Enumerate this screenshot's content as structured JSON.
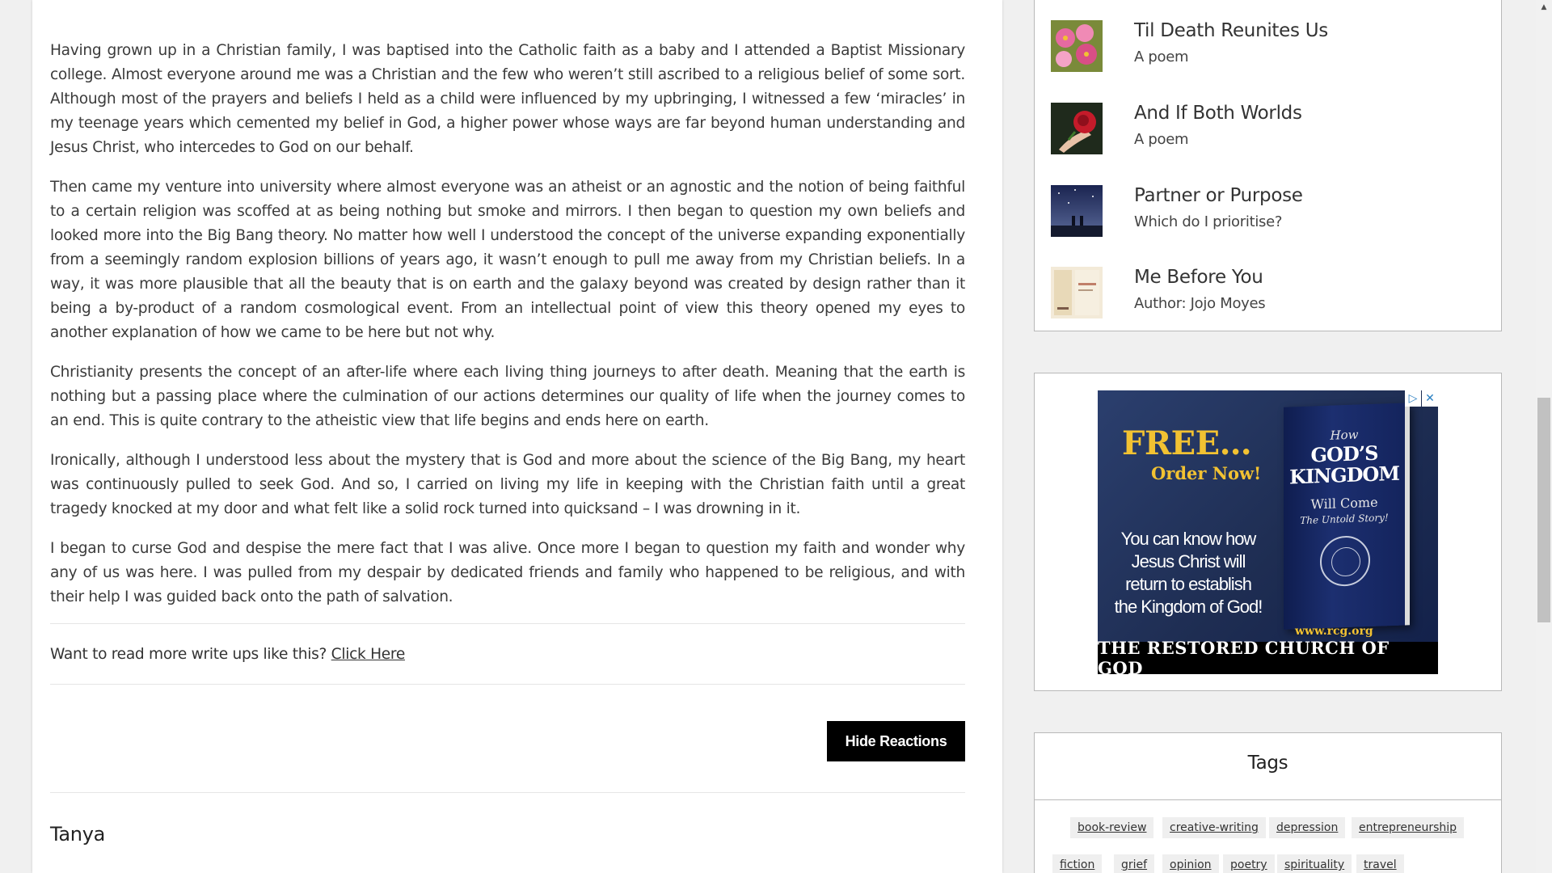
{
  "article": {
    "paragraphs": [
      "Having grown up in a Christian family, I was baptised into the Catholic faith as a baby and I attended a Baptist Missionary college. Almost everyone around me was a Christian and the few who weren’t still ascribed to a religious belief of some sort. Although most of the prayers and beliefs I held as a child were influenced by my upbringing, I witnessed a few ‘miracles’ in my teenage years which cemented my belief in God, a higher power whose ways are far beyond human understanding and Jesus Christ, who intercedes to God on our behalf.",
      "Then came my venture into university where almost everyone was an atheist or an agnostic and the notion of being faithful to a certain religion was scoffed at as being nothing but smoke and mirrors. I then began to question my own beliefs and looked more into the Big Bang theory. No matter how well I understood the concept of the universe expanding exponentially from a seemingly random explosion billions of years ago, it wasn’t enough to pull me away from my Christian beliefs. In a way, it was more plausible that all the beauty that is on earth and the galaxy beyond was created by design rather than it being a by-product of a random cosmological event. From an intellectual point of view this theory opened my eyes to another explanation of how we came to be here but not why.",
      "Christianity presents the concept of an after-life where each living thing journeys to after death. Meaning that the earth is nothing but a passing place where the culmination of our actions determines our quality of life when the journey comes to an end. This is quite contrary to the atheistic view that life begins and ends here on earth.",
      "Ironically, although I understood less about the mystery that is God and more about the science of the Big Bang, my heart was continuously pulled to seek God. And so, I carried on living my life in keeping with the Christian faith until a great tragedy knocked at my door and what felt like a solid rock turned into quicksand – I was drowning in it.",
      "I began to curse God and despise the mere fact that I was alive. Once more I began to question my faith and wonder why any of us was here. I was pulled from my despair by dedicated friends and family who happened to be religious, and with their help I was guided back onto the path of salvation."
    ],
    "more_prompt": "Want to read more write ups like this?",
    "more_link": "Click Here",
    "hide_reactions": "Hide Reactions",
    "comment_author": "Tanya"
  },
  "sidebar": {
    "posts": [
      {
        "title": "Til Death Reunites Us",
        "subtitle": "A poem",
        "thumb_icon": "flowers-thumbnail",
        "thumb_color": "#d94f86"
      },
      {
        "title": "And If Both Worlds",
        "subtitle": "A poem",
        "thumb_icon": "rose-thumbnail",
        "thumb_color": "#c41b2a"
      },
      {
        "title": "Partner or Purpose",
        "subtitle": "Which do I prioritise?",
        "thumb_icon": "night-sky-thumbnail",
        "thumb_color": "#2b3a66"
      },
      {
        "title": "Me Before You",
        "subtitle": "Author: Jojo Moyes",
        "thumb_icon": "book-cover-thumbnail",
        "thumb_color": "#e8d9b8"
      }
    ],
    "ad": {
      "free": "FREE…",
      "order": "Order Now!",
      "body": "You can know how Jesus Christ will return to establish the Kingdom of God!",
      "book_how": "How",
      "book_title": "GOD’S KINGDOM",
      "book_will": "Will Come",
      "book_untold": "The Untold Story!",
      "url": "www.rcg.org",
      "footer": "THE RESTORED CHURCH OF GOD",
      "adchoices_icon": "play-triangle-icon",
      "close_icon": "close-icon"
    },
    "tags": {
      "title": "Tags",
      "items": [
        "book-review",
        "creative-writing",
        "depression",
        "entrepreneurship",
        "fiction",
        "grief",
        "opinion",
        "poetry",
        "spirituality",
        "travel"
      ]
    }
  },
  "colors": {
    "page_bg": "#f0f0f0",
    "button_bg": "#000000",
    "ad_gold": "#f2c232",
    "ad_navy": "#1e2d52"
  }
}
